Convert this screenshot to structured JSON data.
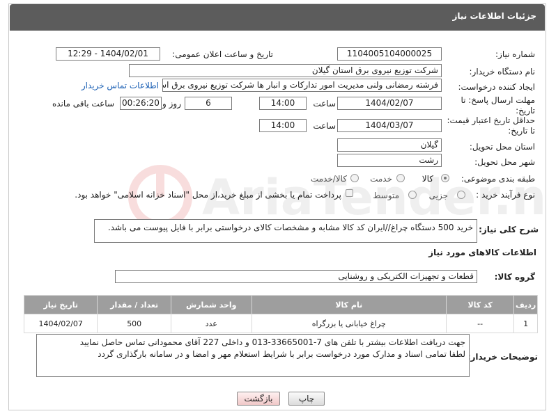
{
  "header": {
    "title": "جزئیات اطلاعات نیاز"
  },
  "form": {
    "need_number": {
      "label": "شماره نیاز:",
      "value": "1104005104000025"
    },
    "announce": {
      "label": "تاریخ و ساعت اعلان عمومی:",
      "value": "1404/02/01 - 12:29"
    },
    "buyer_org": {
      "label": "نام دستگاه خریدار:",
      "value": "شرکت توزیع نیروی برق استان گیلان"
    },
    "requester": {
      "label": "ایجاد کننده درخواست:",
      "value": "فرشته رمضانی ولنی مدیریت امور تدارکات و انبار ها شرکت توزیع نیروی برق استان گیلان",
      "contact_link": "اطلاعات تماس خریدار"
    },
    "reply_deadline": {
      "label": "مهلت ارسال پاسخ: تا تاریخ:",
      "date": "1404/02/07",
      "time_label": "ساعت",
      "time": "14:00",
      "days": "6",
      "days_label": "روز و",
      "remaining": "00:26:20",
      "remaining_label": "ساعت باقی مانده"
    },
    "price_validity": {
      "label": "حداقل تاریخ اعتبار قیمت: تا تاریخ:",
      "date": "1404/03/07",
      "time_label": "ساعت",
      "time": "14:00"
    },
    "delivery_province": {
      "label": "استان محل تحویل:",
      "value": "گیلان"
    },
    "delivery_city": {
      "label": "شهر محل تحویل:",
      "value": "رشت"
    },
    "category": {
      "label": "طبقه بندی موضوعی:",
      "options": [
        "کالا",
        "خدمت",
        "کالا/خدمت"
      ],
      "selected": "کالا"
    },
    "purchase_type": {
      "label": "نوع فرآیند خرید :",
      "options": [
        "جزیی",
        "متوسط"
      ],
      "selected": "جزیی",
      "payment_note": "پرداخت تمام یا بخشی از مبلغ خرید،از محل \"اسناد خزانه اسلامی\" خواهد بود."
    }
  },
  "description": {
    "label": "شرح کلی نیاز:",
    "text": "خرید 500 دستگاه چراغ//ایران کد کالا مشابه و مشخصات کالای درخواستی برابر با فایل پیوست می باشد."
  },
  "goods_section": {
    "title": "اطلاعات کالاهای مورد نیاز",
    "group_label": "گروه کالا:",
    "group_value": "قطعات و تجهیزات الکتریکی و روشنایی"
  },
  "table": {
    "headers": [
      "ردیف",
      "کد کالا",
      "نام کالا",
      "واحد شمارش",
      "تعداد / مقدار",
      "تاریخ نیاز"
    ],
    "rows": [
      [
        "1",
        "--",
        "چراغ خیابانی یا بزرگراه",
        "عدد",
        "500",
        "1404/02/07"
      ]
    ]
  },
  "buyer_notes": {
    "label": "توضیحات خریدار:",
    "line1": "جهت دریافت اطلاعات بیشتر با تلفن های 7-33665001-013 و داخلی 227 آقای محمودانی تماس حاصل نمایید",
    "line2": "لطفا تمامی اسناد و مدارک مورد درخواست برابر با شرایط استعلام مهر و امضا و در سامانه بارگذاری گردد"
  },
  "buttons": {
    "print": "چاپ",
    "back": "بازگشت"
  },
  "watermark": "AriaTender.net",
  "colors": {
    "header_bg": "#5c5c5c",
    "table_header_bg": "#9e9e9e",
    "link": "#1a5fb4"
  }
}
